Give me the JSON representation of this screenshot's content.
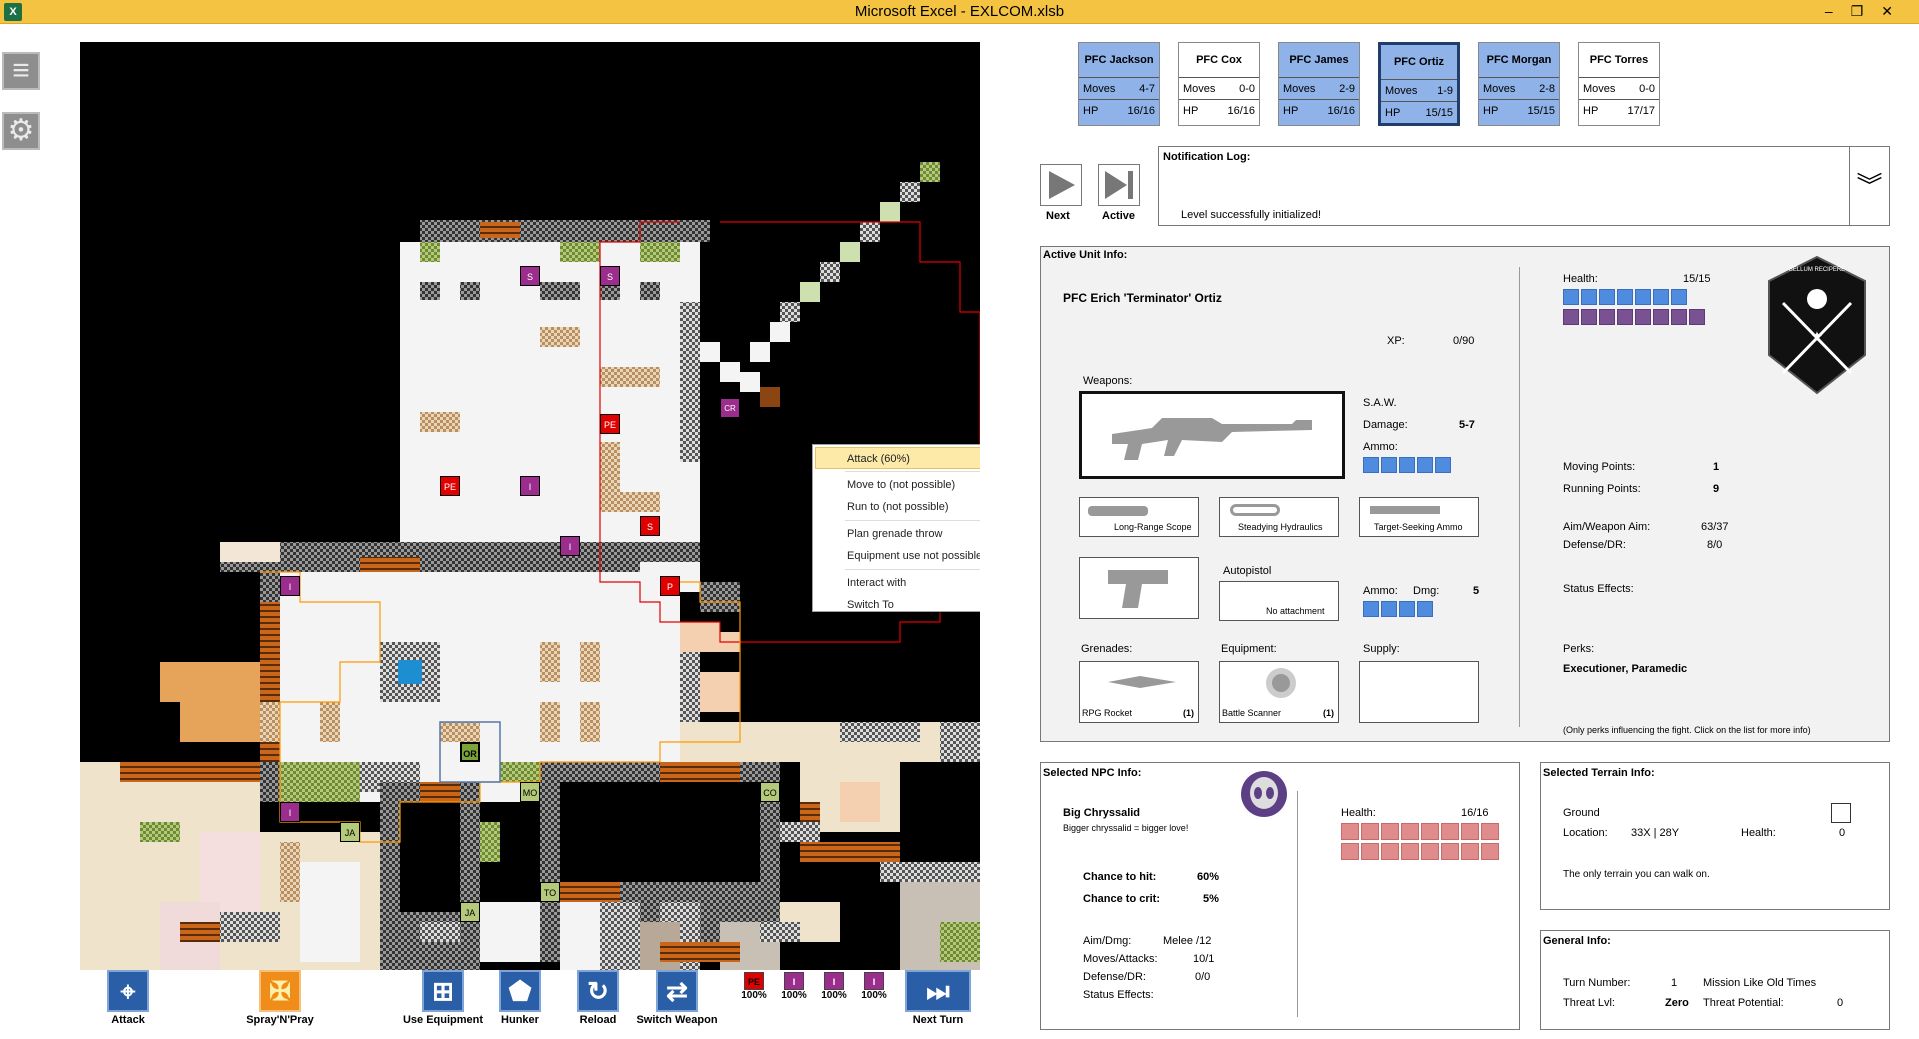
{
  "window": {
    "title": "Microsoft Excel - EXLCOM.xlsb",
    "app_icon": "X"
  },
  "context_menu": {
    "items": [
      "Attack (60%)",
      "Move to (not possible)",
      "Run to (not possible)",
      "Plan grenade throw",
      "Equipment use not possible (too far)",
      "Interact with",
      "Switch To"
    ],
    "highlighted": 0
  },
  "map": {
    "tokens": {
      "s1": "S",
      "s2": "S",
      "pe1": "PE",
      "pe2": "PE",
      "i1": "I",
      "i2": "I",
      "i3": "I",
      "i4": "I",
      "s3": "S",
      "p1": "P",
      "or": "OR",
      "mo": "MO",
      "co": "CO",
      "ja1": "JA",
      "ja2": "JA",
      "to": "TO",
      "cr": "CR"
    }
  },
  "toolbar": {
    "attack": "Attack",
    "spray": "Spray'N'Pray",
    "use_equipment": "Use Equipment",
    "hunker": "Hunker",
    "reload": "Reload",
    "switch_weapon": "Switch Weapon",
    "next_turn": "Next Turn",
    "markers": [
      {
        "tag": "PE",
        "pct": "100%",
        "color": "#e00000"
      },
      {
        "tag": "I",
        "pct": "100%",
        "color": "#9b2d8c"
      },
      {
        "tag": "I",
        "pct": "100%",
        "color": "#9b2d8c"
      },
      {
        "tag": "I",
        "pct": "100%",
        "color": "#9b2d8c"
      }
    ]
  },
  "units": [
    {
      "name": "PFC Jackson",
      "moves": "4-7",
      "hp": "16/16",
      "highlight": true,
      "active": false
    },
    {
      "name": "PFC Cox",
      "moves": "0-0",
      "hp": "16/16",
      "highlight": false,
      "active": false
    },
    {
      "name": "PFC James",
      "moves": "2-9",
      "hp": "16/16",
      "highlight": true,
      "active": false
    },
    {
      "name": "PFC Ortiz",
      "moves": "1-9",
      "hp": "15/15",
      "highlight": true,
      "active": true
    },
    {
      "name": "PFC Morgan",
      "moves": "2-8",
      "hp": "15/15",
      "highlight": true,
      "active": false
    },
    {
      "name": "PFC Torres",
      "moves": "0-0",
      "hp": "17/17",
      "highlight": false,
      "active": false
    }
  ],
  "labels": {
    "moves": "Moves",
    "hp": "HP"
  },
  "nav": {
    "next": "Next",
    "active": "Active"
  },
  "notification": {
    "title": "Notification Log:",
    "message": "Level successfully initialized!"
  },
  "active_unit": {
    "title": "Active Unit Info:",
    "name": "PFC Erich 'Terminator' Ortiz",
    "xp_label": "XP:",
    "xp": "0/90",
    "health_label": "Health:",
    "health": "15/15",
    "weapons_label": "Weapons:",
    "primary": {
      "name": "S.A.W.",
      "damage_label": "Damage:",
      "damage": "5-7",
      "ammo_label": "Ammo:",
      "ammo_blocks": 5
    },
    "attachments": [
      "Long-Range Scope",
      "Steadying Hydraulics",
      "Target-Seeking Ammo"
    ],
    "secondary": {
      "name": "Autopistol",
      "attachment": "No attachment",
      "ammo_label": "Ammo:",
      "dmg_label": "Dmg:",
      "dmg": "5",
      "ammo_blocks": 4
    },
    "grenades_label": "Grenades:",
    "grenade": "RPG Rocket",
    "grenade_count": "(1)",
    "equipment_label": "Equipment:",
    "equipment": "Battle Scanner",
    "equipment_count": "(1)",
    "supply_label": "Supply:",
    "moving_points_label": "Moving Points:",
    "moving_points": "1",
    "running_points_label": "Running Points:",
    "running_points": "9",
    "aim_label": "Aim/Weapon Aim:",
    "aim": "63/37",
    "defense_label": "Defense/DR:",
    "defense": "8/0",
    "status_label": "Status Effects:",
    "perks_label": "Perks:",
    "perks": "Executioner, Paramedic",
    "perks_note": "(Only perks influencing the fight. Click on the list for more info)",
    "badge_text": "BELLUM RECIPERE"
  },
  "npc": {
    "title": "Selected NPC Info:",
    "name": "Big Chryssalid",
    "desc": "Bigger chryssalid = bigger love!",
    "health_label": "Health:",
    "health": "16/16",
    "hit_label": "Chance to hit:",
    "hit": "60%",
    "crit_label": "Chance to crit:",
    "crit": "5%",
    "aim_label": "Aim/Dmg:",
    "aim": "Melee /12",
    "moves_label": "Moves/Attacks:",
    "moves": "10/1",
    "def_label": "Defense/DR:",
    "def": "0/0",
    "status_label": "Status Effects:"
  },
  "terrain": {
    "title": "Selected Terrain Info:",
    "type": "Ground",
    "location_label": "Location:",
    "location": "33X | 28Y",
    "health_label": "Health:",
    "health": "0",
    "desc": "The only terrain you can walk on."
  },
  "general": {
    "title": "General Info:",
    "turn_label": "Turn Number:",
    "turn": "1",
    "mission": "Mission Like Old Times",
    "threat_label": "Threat Lvl:",
    "threat": "Zero",
    "potential_label": "Threat Potential:",
    "potential": "0"
  },
  "colors": {
    "title_bar": "#f3c341",
    "accent_blue": "#2a5ea6",
    "health_blue": "#4f8ce0",
    "health_purple": "#7a5193",
    "npc_health": "#e08c8c",
    "red_token": "#e00000",
    "purple_token": "#9b2d8c"
  }
}
